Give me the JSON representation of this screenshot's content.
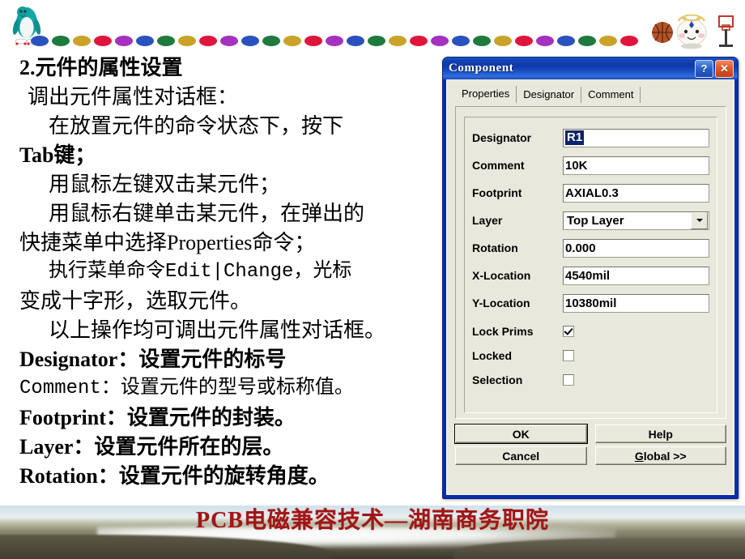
{
  "slide": {
    "decor": {
      "left_mascot": "penguin-mascot",
      "right_mascot": "basketball-mascot",
      "dot_colors": [
        "#2a52be",
        "#1f7a3d",
        "#c9a227",
        "#e0153c",
        "#a431c0"
      ],
      "dot_count": 29
    },
    "content_lines": [
      {
        "text": "2.元件的属性设置",
        "style": "bold",
        "indent": 0
      },
      {
        "text": "调出元件属性对话框：",
        "style": "normal",
        "indent": 1
      },
      {
        "text": "在放置元件的命令状态下，按下",
        "style": "normal",
        "indent": 2
      },
      {
        "text": "Tab键；",
        "style": "bold-lat",
        "indent": 0
      },
      {
        "text": "用鼠标左键双击某元件；",
        "style": "normal",
        "indent": 2
      },
      {
        "text": "用鼠标右键单击某元件，在弹出的",
        "style": "normal",
        "indent": 2
      },
      {
        "text": "快捷菜单中选择Properties命令；",
        "style": "normal",
        "indent": 0
      },
      {
        "text": "执行菜单命令Edit|Change，光标",
        "style": "mono",
        "indent": 2
      },
      {
        "text": "变成十字形，选取元件。",
        "style": "normal",
        "indent": 0
      },
      {
        "text": "以上操作均可调出元件属性对话框。",
        "style": "normal",
        "indent": 2
      },
      {
        "text": "Designator：设置元件的标号",
        "style": "bold",
        "indent": 0
      },
      {
        "text": "Comment：设置元件的型号或标称值。",
        "style": "mono",
        "indent": 0
      },
      {
        "text": "Footprint：设置元件的封装。",
        "style": "bold",
        "indent": 0
      },
      {
        "text": "Layer：设置元件所在的层。",
        "style": "bold",
        "indent": 0
      },
      {
        "text": "Rotation：设置元件的旋转角度。",
        "style": "bold",
        "indent": 0
      }
    ],
    "footer": {
      "title": "PCB电磁兼容技术—湖南商务职院",
      "title_color": "#a31515"
    }
  },
  "dialog": {
    "title": "Component",
    "titlebar_buttons": {
      "help": "?",
      "close": "✕"
    },
    "tabs": [
      {
        "label": "Properties",
        "active": true
      },
      {
        "label": "Designator",
        "active": false
      },
      {
        "label": "Comment",
        "active": false
      }
    ],
    "fields": [
      {
        "label": "Designator",
        "value": "R1",
        "type": "text",
        "selected": true
      },
      {
        "label": "Comment",
        "value": "10K",
        "type": "text",
        "selected": false
      },
      {
        "label": "Footprint",
        "value": "AXIAL0.3",
        "type": "text",
        "selected": false
      },
      {
        "label": "Layer",
        "value": "Top Layer",
        "type": "combo",
        "selected": false
      },
      {
        "label": "Rotation",
        "value": "0.000",
        "type": "text",
        "selected": false
      },
      {
        "label": "X-Location",
        "value": "4540mil",
        "type": "text",
        "selected": false
      },
      {
        "label": "Y-Location",
        "value": "10380mil",
        "type": "text",
        "selected": false
      }
    ],
    "checkboxes": [
      {
        "label": "Lock Prims",
        "checked": true
      },
      {
        "label": "Locked",
        "checked": false
      },
      {
        "label": "Selection",
        "checked": false
      }
    ],
    "buttons": [
      {
        "label": "OK",
        "default": true,
        "accel": ""
      },
      {
        "label": "Help",
        "default": false,
        "accel": ""
      },
      {
        "label": "Cancel",
        "default": false,
        "accel": ""
      },
      {
        "label": "Global >>",
        "default": false,
        "accel": "G"
      }
    ]
  }
}
